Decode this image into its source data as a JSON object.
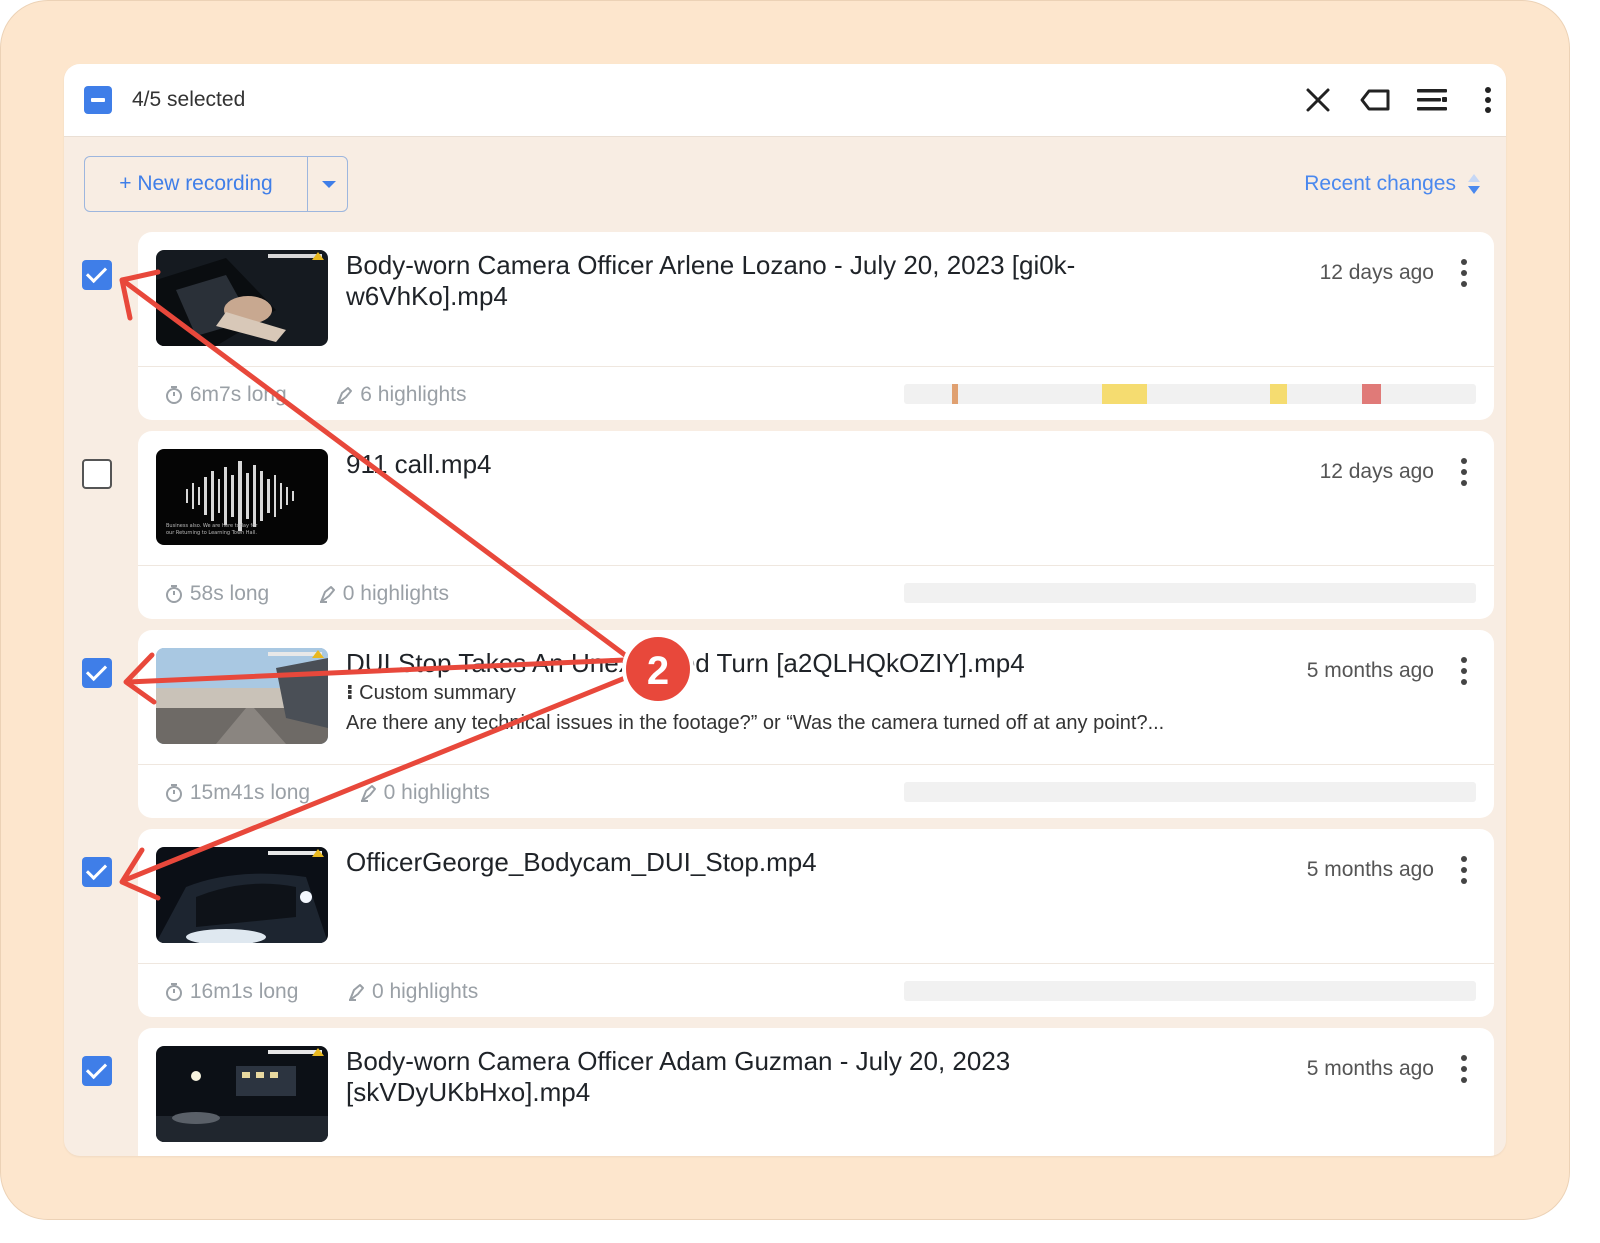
{
  "toolbar": {
    "selected_text": "4/5 selected",
    "icons": [
      "close-icon",
      "tag-icon",
      "list-icon",
      "more-vertical-icon"
    ]
  },
  "actions": {
    "new_recording_label": "+ New recording",
    "sort_label": "Recent changes"
  },
  "annotation": {
    "step_number": "2",
    "color": "#e8483b"
  },
  "recordings": [
    {
      "title": "Body-worn Camera Officer Arlene Lozano - July 20, 2023 [gi0k-w6VhKo].mp4",
      "time_ago": "12 days ago",
      "duration": "6m7s long",
      "highlights": "6 highlights",
      "selected": true,
      "highlight_marks": [
        {
          "start": 0.084,
          "end": 0.094,
          "color": "#e0a070"
        },
        {
          "start": 0.346,
          "end": 0.424,
          "color": "#f5dc70"
        },
        {
          "start": 0.64,
          "end": 0.67,
          "color": "#f5dc70"
        },
        {
          "start": 0.8,
          "end": 0.834,
          "color": "#e07a78"
        }
      ]
    },
    {
      "title": "911 call.mp4",
      "time_ago": "12 days ago",
      "duration": "58s long",
      "highlights": "0 highlights",
      "selected": false,
      "thumb_caption_line1": "Business also. We are here today for",
      "thumb_caption_line2": "our Returning to Learning Town Hall."
    },
    {
      "title": "DUI Stop Takes An Unexpected Turn [a2QLHQkOZIY].mp4",
      "custom_summary_label": "Custom summary",
      "summary_text": "Are there any technical issues in the footage?” or “Was the camera turned off at any point?...",
      "time_ago": "5 months ago",
      "duration": "15m41s long",
      "highlights": "0 highlights",
      "selected": true
    },
    {
      "title": "OfficerGeorge_Bodycam_DUI_Stop.mp4",
      "time_ago": "5 months ago",
      "duration": "16m1s long",
      "highlights": "0 highlights",
      "selected": true
    },
    {
      "title": "Body-worn Camera Officer Adam Guzman - July 20, 2023 [skVDyUKbHxo].mp4",
      "time_ago": "5 months ago",
      "selected": true
    }
  ]
}
